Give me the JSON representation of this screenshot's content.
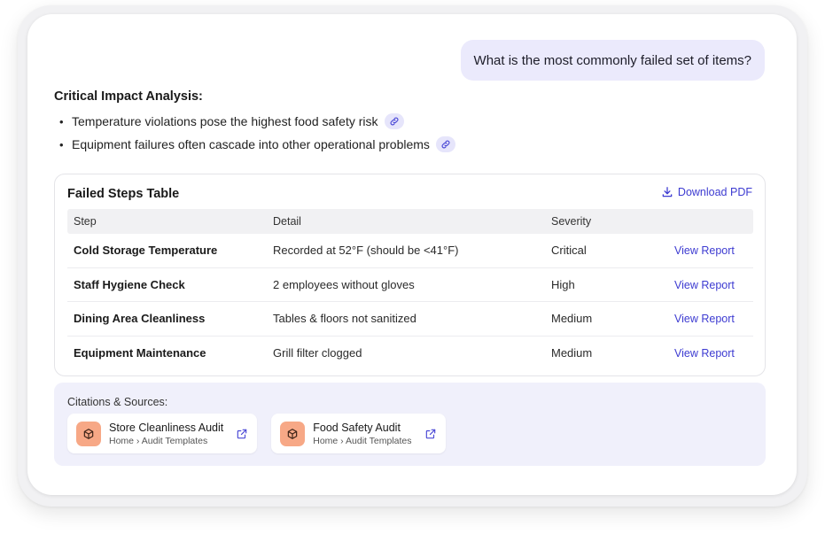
{
  "user_message": "What is the most commonly failed set of items?",
  "analysis": {
    "title": "Critical Impact Analysis:",
    "bullets": [
      "Temperature violations pose the highest food safety risk",
      "Equipment failures often cascade into other operational problems"
    ]
  },
  "failed_steps": {
    "title": "Failed Steps Table",
    "download_label": "Download PDF",
    "columns": [
      "Step",
      "Detail",
      "Severity"
    ],
    "rows": [
      {
        "step": "Cold Storage Temperature",
        "detail": "Recorded at 52°F (should be <41°F)",
        "severity": "Critical",
        "action": "View Report"
      },
      {
        "step": "Staff Hygiene Check",
        "detail": "2 employees without gloves",
        "severity": "High",
        "action": "View Report"
      },
      {
        "step": "Dining Area Cleanliness",
        "detail": "Tables & floors not sanitized",
        "severity": "Medium",
        "action": "View Report"
      },
      {
        "step": "Equipment Maintenance",
        "detail": "Grill filter clogged",
        "severity": "Medium",
        "action": "View Report"
      }
    ]
  },
  "citations": {
    "title": "Citations & Sources:",
    "items": [
      {
        "name": "Store Cleanliness Audit",
        "path": "Home › Audit Templates"
      },
      {
        "name": "Food Safety Audit",
        "path": "Home › Audit Templates"
      }
    ]
  },
  "colors": {
    "accent": "#3d3bd1",
    "bubble_bg": "#ebeafc",
    "citation_icon_bg": "#f7a886"
  },
  "icons": {
    "source_link": "link-icon",
    "download": "download-icon",
    "citation": "box-icon",
    "open": "external-link-icon"
  }
}
